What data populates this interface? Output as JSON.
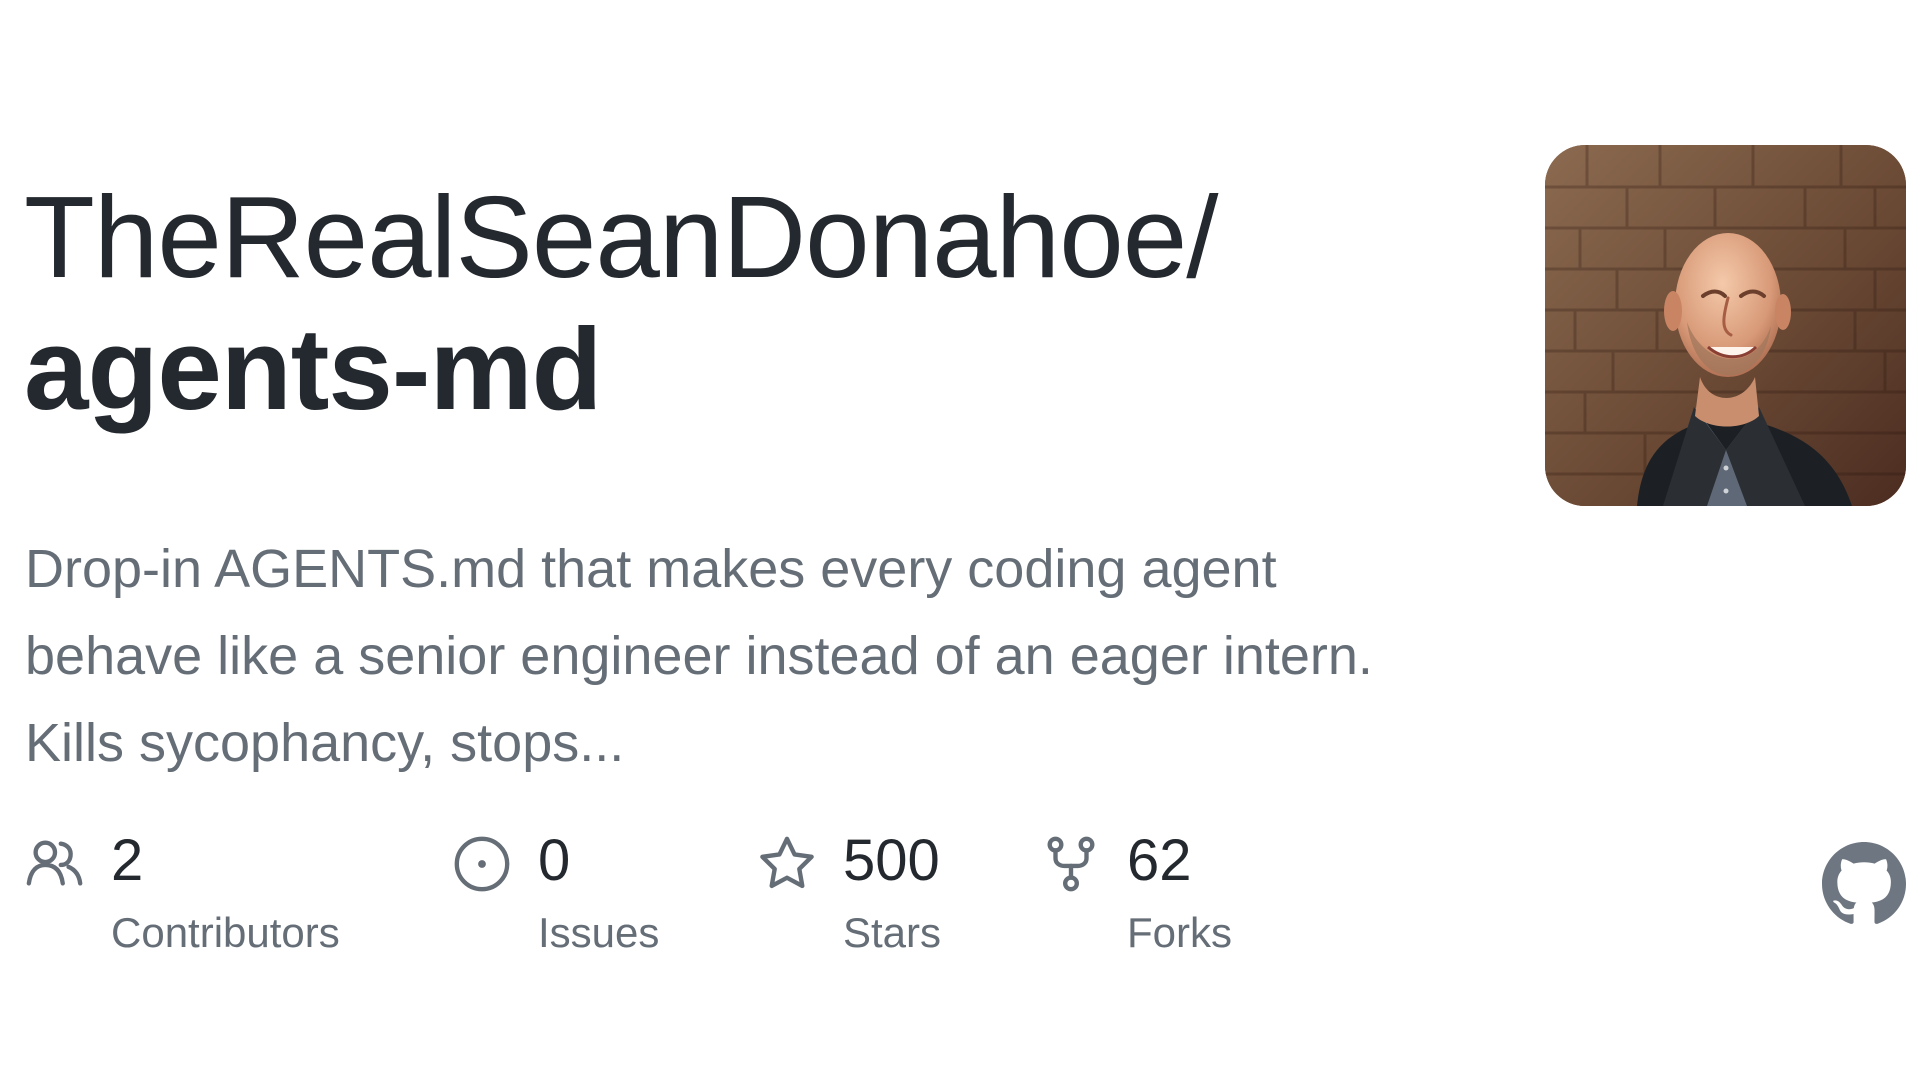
{
  "repository": {
    "owner_path": "TheRealSeanDonahoe/",
    "name": "agents-md",
    "description": "Drop-in AGENTS.md that makes every coding agent behave like a senior engineer instead of an eager intern. Kills sycophancy, stops..."
  },
  "avatar": {
    "icon": "profile-photo"
  },
  "stats": [
    {
      "icon": "contributors-icon",
      "value": "2",
      "label": "Contributors"
    },
    {
      "icon": "issues-icon",
      "value": "0",
      "label": "Issues"
    },
    {
      "icon": "star-icon",
      "value": "500",
      "label": "Stars"
    },
    {
      "icon": "fork-icon",
      "value": "62",
      "label": "Forks"
    }
  ],
  "brand": {
    "icon": "github-mark-icon"
  },
  "colors": {
    "primary_text": "#24292f",
    "secondary_text": "#656d76",
    "brand_gray": "#6e7781",
    "background": "#ffffff"
  }
}
